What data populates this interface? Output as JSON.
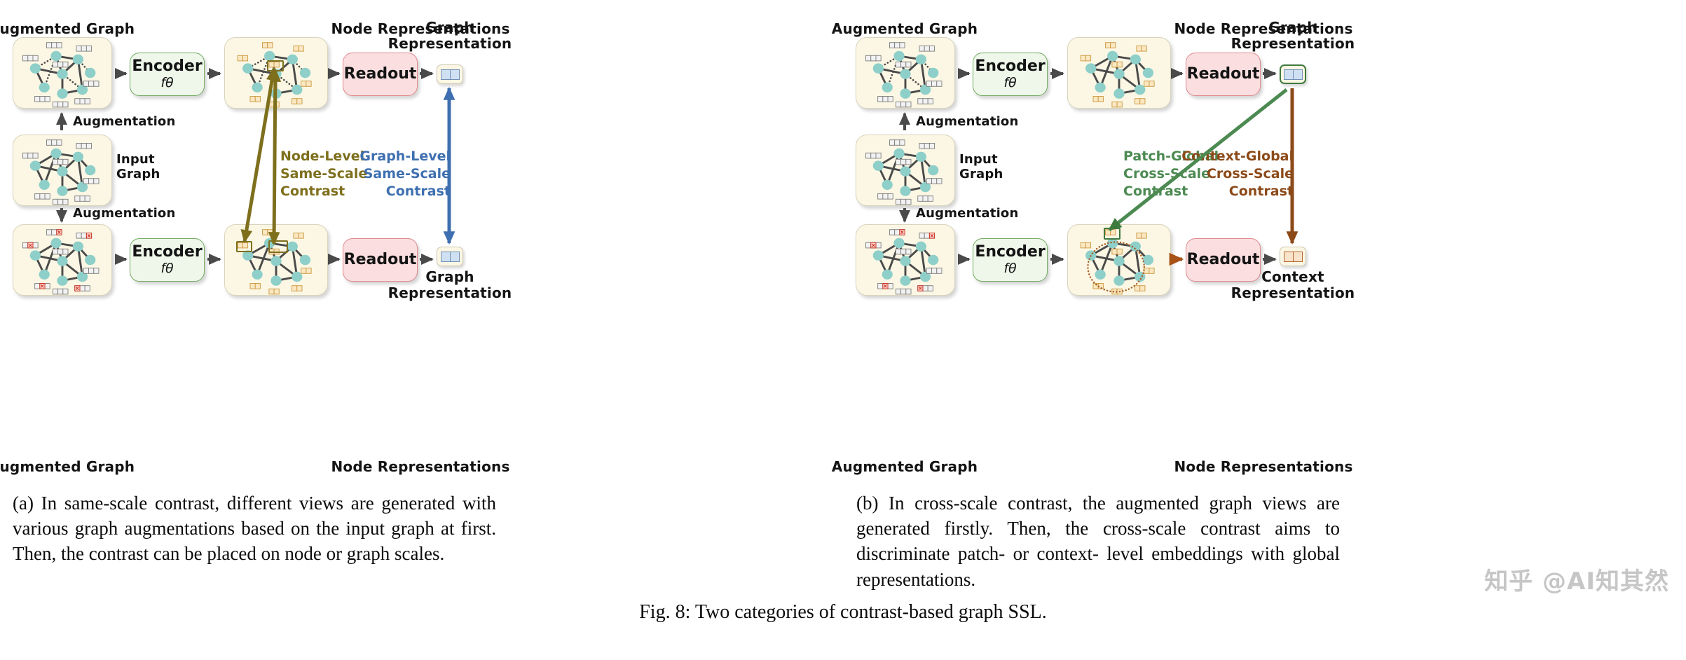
{
  "figure": {
    "fig_caption": "Fig. 8: Two categories of contrast-based graph SSL.",
    "watermark": "知乎 @AI知其然"
  },
  "panel_a": {
    "caption": "(a) In same-scale contrast, different views are generated with various graph augmentations based on the input graph at first. Then, the contrast can be placed on node or graph scales.",
    "top_graph_title": "Augmented Graph",
    "top_noderep_title": "Node Representations",
    "bottom_graph_title": "Augmented Graph",
    "bottom_noderep_title": "Node Representations",
    "input_graph_label": "Input\nGraph",
    "augmentation_up_label": "Augmentation",
    "augmentation_down_label": "Augmentation",
    "encoder_top": {
      "name": "Encoder",
      "sub": "fθ"
    },
    "encoder_bottom": {
      "name": "Encoder",
      "sub": "fθ"
    },
    "readout_top": "Readout",
    "readout_bottom": "Readout",
    "graph_rep_top": "Graph\nRepresentation",
    "graph_rep_bottom": "Graph\nRepresentation",
    "contrast_node": "Node-Level\nSame-Scale\nContrast",
    "contrast_graph": "Graph-Level\nSame-Scale\nContrast",
    "colors": {
      "node_contrast": "#7e6f1d",
      "graph_contrast": "#3e6fb0",
      "card_fill": "#fbf7e4",
      "node_fill": "#8ecfc9",
      "encoder_fill": "#eef7ea",
      "encoder_border": "#73ab62",
      "readout_fill": "#fbdfe0",
      "readout_border": "#e0898c",
      "arrow_gray": "#4a4a4a"
    }
  },
  "panel_b": {
    "caption": "(b) In cross-scale contrast, the augmented graph views are generated firstly. Then, the cross-scale contrast aims to discriminate patch- or context- level embeddings with global representations.",
    "top_graph_title": "Augmented Graph",
    "top_noderep_title": "Node Representations",
    "bottom_graph_title": "Augmented Graph",
    "bottom_noderep_title": "Node Representations",
    "input_graph_label": "Input\nGraph",
    "augmentation_up_label": "Augmentation",
    "augmentation_down_label": "Augmentation",
    "encoder_top": {
      "name": "Encoder",
      "sub": "fθ"
    },
    "encoder_bottom": {
      "name": "Encoder",
      "sub": "fθ"
    },
    "readout_top": "Readout",
    "readout_bottom": "Readout",
    "graph_rep_top": "Graph\nRepresentation",
    "context_rep_bottom": "Context\nRepresentation",
    "contrast_patch": "Patch-Global\nCross-Scale\nContrast",
    "contrast_context": "Context-Global\nCross-Scale\nContrast",
    "colors": {
      "patch_contrast": "#4c8a52",
      "context_contrast": "#8c4a19",
      "context_circle": "#a85d22",
      "patch_highlight": "#3f7a3f"
    }
  },
  "chart_data": {
    "type": "diagram",
    "title": "Two categories of contrast-based graph SSL",
    "panels": [
      {
        "id": "a",
        "label": "same-scale contrast",
        "stages": [
          "Augmented Graph",
          "Encoder fθ",
          "Node Representations",
          "Readout",
          "Graph Representation"
        ],
        "contrast_links": [
          {
            "name": "Node-Level Same-Scale Contrast",
            "from": "Node Representations (view 1)",
            "to": "Node Representations (view 2)",
            "color": "#7e6f1d"
          },
          {
            "name": "Graph-Level Same-Scale Contrast",
            "from": "Graph Representation (view 1)",
            "to": "Graph Representation (view 2)",
            "color": "#3e6fb0"
          }
        ]
      },
      {
        "id": "b",
        "label": "cross-scale contrast",
        "stages": [
          "Augmented Graph",
          "Encoder fθ",
          "Node Representations",
          "Readout",
          "Graph Representation / Context Representation"
        ],
        "contrast_links": [
          {
            "name": "Patch-Global Cross-Scale Contrast",
            "from": "Patch node embedding (view 2)",
            "to": "Graph Representation (view 1)",
            "color": "#4c8a52"
          },
          {
            "name": "Context-Global Cross-Scale Contrast",
            "from": "Graph Representation (view 1)",
            "to": "Context Representation (view 2)",
            "color": "#8c4a19"
          }
        ]
      }
    ],
    "graph_nodes_per_card": 8,
    "feature_vector_cells_input": 3,
    "feature_vector_cells_embedding": 2
  }
}
